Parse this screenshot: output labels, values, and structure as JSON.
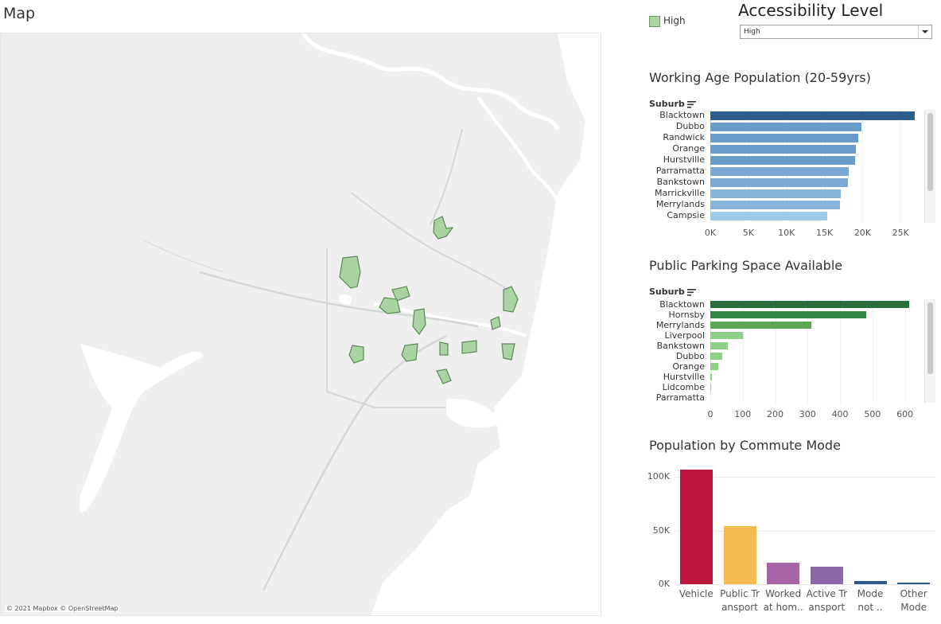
{
  "map": {
    "title": "Map",
    "credit": "© 2021 Mapbox © OpenStreetMap"
  },
  "legend": {
    "label": "High",
    "swatch_color": "#a9d3a0"
  },
  "accessibility": {
    "title": "Accessibility Level",
    "selected": "High"
  },
  "working_age": {
    "title": "Working Age Population (20-59yrs)",
    "axis_header": "Suburb",
    "chart_data": {
      "type": "bar",
      "orientation": "horizontal",
      "categories": [
        "Blacktown",
        "Dubbo",
        "Randwick",
        "Orange",
        "Hurstville",
        "Parramatta",
        "Bankstown",
        "Marrickville",
        "Merrylands",
        "Campsie"
      ],
      "values": [
        26800,
        19900,
        19400,
        19100,
        19000,
        18200,
        18100,
        17100,
        17000,
        15400
      ],
      "xlim": [
        0,
        28000
      ],
      "ticks": [
        0,
        5000,
        10000,
        15000,
        20000,
        25000
      ],
      "tick_labels": [
        "0K",
        "5K",
        "10K",
        "15K",
        "20K",
        "25K"
      ],
      "colors": [
        "#2f5e8c",
        "#6a9cca",
        "#6a9cca",
        "#6a9cca",
        "#6a9cca",
        "#7aa8d2",
        "#7aa8d2",
        "#88b4da",
        "#88b4da",
        "#9ccae8"
      ]
    }
  },
  "parking": {
    "title": "Public Parking Space Available",
    "axis_header": "Suburb",
    "chart_data": {
      "type": "bar",
      "orientation": "horizontal",
      "categories": [
        "Blacktown",
        "Hornsby",
        "Merrylands",
        "Liverpool",
        "Bankstown",
        "Dubbo",
        "Orange",
        "Hurstville",
        "Lidcombe",
        "Parramatta"
      ],
      "values": [
        612,
        480,
        312,
        100,
        55,
        38,
        25,
        5,
        3,
        0
      ],
      "xlim": [
        0,
        650
      ],
      "ticks": [
        0,
        100,
        200,
        300,
        400,
        500,
        600
      ],
      "tick_labels": [
        "0",
        "100",
        "200",
        "300",
        "400",
        "500",
        "600"
      ],
      "colors": [
        "#2a6e3c",
        "#358544",
        "#5aa653",
        "#8fd088",
        "#8fd088",
        "#8fd088",
        "#8fd088",
        "#8fd088",
        "#8fd088",
        "#8fd088"
      ]
    }
  },
  "commute": {
    "title": "Population by Commute Mode",
    "chart_data": {
      "type": "bar",
      "categories": [
        "Vehicle",
        "Public Transport",
        "Worked at home",
        "Active Transport",
        "Mode not stated",
        "Other Mode"
      ],
      "category_lines": [
        [
          "Vehicle"
        ],
        [
          "Public Tr",
          "ansport"
        ],
        [
          "Worked",
          "at hom.."
        ],
        [
          "Active Tr",
          "ansport"
        ],
        [
          "Mode",
          "not .."
        ],
        [
          "Other",
          "Mode"
        ]
      ],
      "values": [
        107000,
        54000,
        20000,
        16000,
        3000,
        1500
      ],
      "ylim": [
        0,
        110000
      ],
      "ticks": [
        0,
        50000,
        100000
      ],
      "tick_labels": [
        "0K",
        "50K",
        "100K"
      ],
      "colors": [
        "#be173d",
        "#f4b94f",
        "#a765a8",
        "#8a67a8",
        "#2e5a8a",
        "#2e5a8a"
      ]
    }
  }
}
